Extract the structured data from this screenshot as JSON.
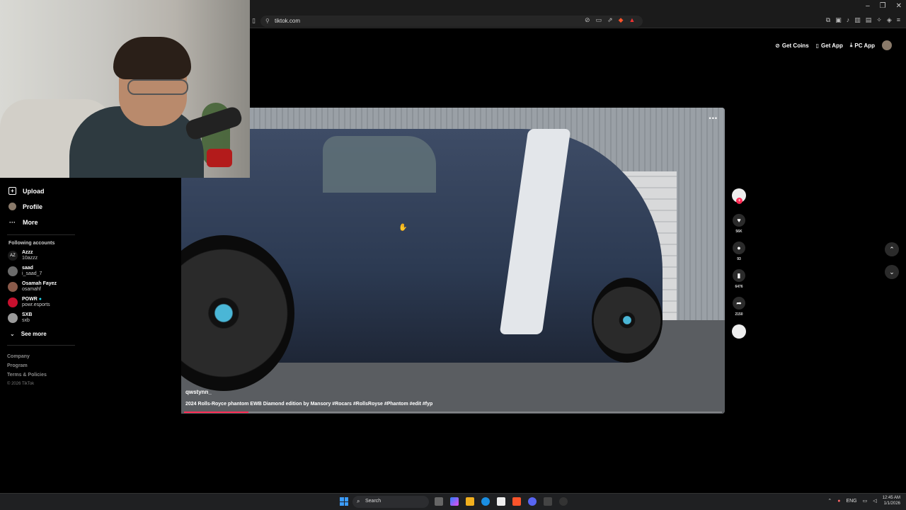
{
  "browser": {
    "url": "tiktok.com",
    "window_controls": [
      "–",
      "❐",
      "✕"
    ]
  },
  "top_actions": {
    "get_coins": "Get Coins",
    "get_app": "Get App",
    "pc_app": "PC App"
  },
  "sidebar": {
    "nav": [
      {
        "label": "Upload",
        "icon": "plus-square-icon"
      },
      {
        "label": "Profile",
        "icon": "avatar-icon"
      },
      {
        "label": "More",
        "icon": "ellipsis-icon"
      }
    ],
    "following_title": "Following accounts",
    "accounts": [
      {
        "name": "Azzz",
        "handle": "10azzz",
        "color": "#222222"
      },
      {
        "name": "saad",
        "handle": "i_saad_7",
        "color": "#6b6b6b"
      },
      {
        "name": "Osamah Fayez",
        "handle": "osamahf",
        "color": "#8a5a4a"
      },
      {
        "name": "POWR",
        "handle": "powr.esports",
        "color": "#c8102e",
        "verified": true
      },
      {
        "name": "SXB",
        "handle": "sxb",
        "color": "#9a9a9a"
      }
    ],
    "see_more": "See more",
    "footer_links": [
      "Company",
      "Program",
      "Terms & Policies"
    ],
    "copyright": "© 2026 TikTok"
  },
  "video": {
    "author": "qwstynn_",
    "caption": "2024 Rolls-Royce phantom EWB Diamond edition by Mansory #Rocars #RollsRoyse #Phantom #edit #fyp",
    "progress": 0.12,
    "menu": "•••"
  },
  "actions": {
    "likes": "56K",
    "comments": "93",
    "saves": "6476",
    "shares": "2150"
  },
  "taskbar": {
    "search_placeholder": "Search",
    "language": "ENG",
    "time": "12:45 AM",
    "date": "1/1/2026"
  }
}
